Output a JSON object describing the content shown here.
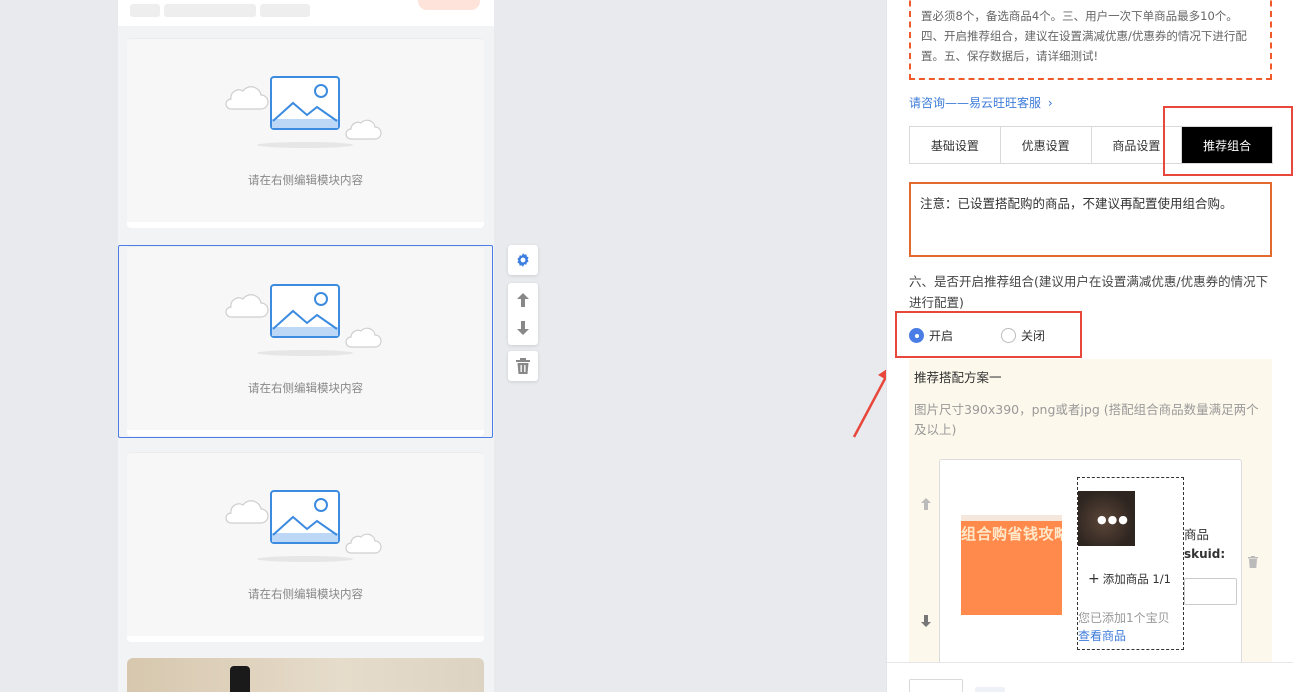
{
  "preview": {
    "placeholder_text": "请在右侧编辑模块内容",
    "module_count": 3
  },
  "settings": {
    "notice_lines": [
      "置必须8个，备选商品4个。三、用户一次下单商品最多10个。",
      "四、开启推荐组合，建议在设置满减优惠/优惠券的情况下进行配",
      "置。五、保存数据后，请详细测试!"
    ],
    "consult_link": "请咨询——易云旺旺客服",
    "tabs": [
      {
        "label": "基础设置",
        "active": false
      },
      {
        "label": "优惠设置",
        "active": false
      },
      {
        "label": "商品设置",
        "active": false
      },
      {
        "label": "推荐组合",
        "active": true
      }
    ],
    "warning_text": "注意：已设置搭配购的商品，不建议再配置使用组合购。",
    "question_text": "六、是否开启推荐组合(建议用户在设置满减优惠/优惠券的情况下进行配置)",
    "radio_options": [
      {
        "label": "开启",
        "checked": true
      },
      {
        "label": "关闭",
        "checked": false
      }
    ],
    "plan": {
      "title": "推荐搭配方案一",
      "tip": "图片尺寸390x390，png或者jpg (搭配组合商品数量满足两个及以上)",
      "poster_text": "组合购省钱攻略",
      "add_goods": "添加商品 1/1",
      "added_prefix": "您已添加1个宝贝",
      "view_goods": "查看商品",
      "goods_label": "商品",
      "skuid_label": "skuid:"
    }
  },
  "colors": {
    "accent_blue": "#4a7ee6",
    "annotation_red": "#e8473c",
    "notice_orange": "#f05a2a",
    "active_tab": "#000000",
    "link_blue": "#3d7bd9",
    "plan_bg": "#fdf8ec",
    "poster_orange": "#ff8a4c"
  }
}
